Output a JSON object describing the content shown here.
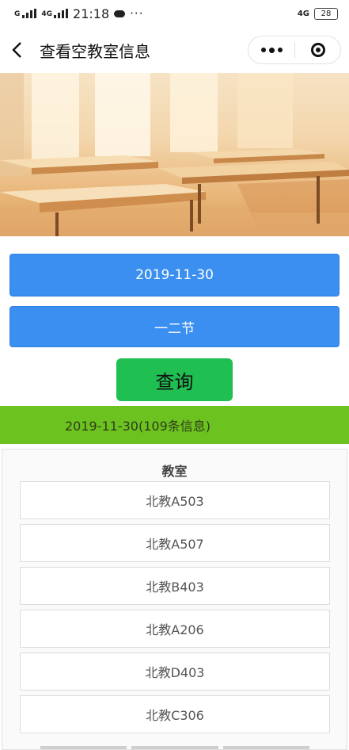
{
  "status_bar": {
    "network_top": "G",
    "network_mid": "4G",
    "time": "21:18",
    "more": "···",
    "network_right": "4G",
    "battery": "28"
  },
  "nav": {
    "title": "查看空教室信息",
    "back_icon": "chevron-left-icon",
    "more_icon": "more-dots-icon",
    "close_icon": "target-circle-icon"
  },
  "banner": {
    "image": "classroom-desks-sunlight"
  },
  "filters": {
    "date": "2019-11-30",
    "period": "一二节",
    "query_label": "查询"
  },
  "result": {
    "summary": "2019-11-30(109条信息)"
  },
  "table": {
    "header": "教室",
    "rows": [
      "北教A503",
      "北教A507",
      "北教B403",
      "北教A206",
      "北教D403",
      "北教C306"
    ]
  },
  "colors": {
    "primary_blue": "#3b8ff0",
    "query_green": "#1fbf51",
    "result_green": "#6cc21f"
  }
}
